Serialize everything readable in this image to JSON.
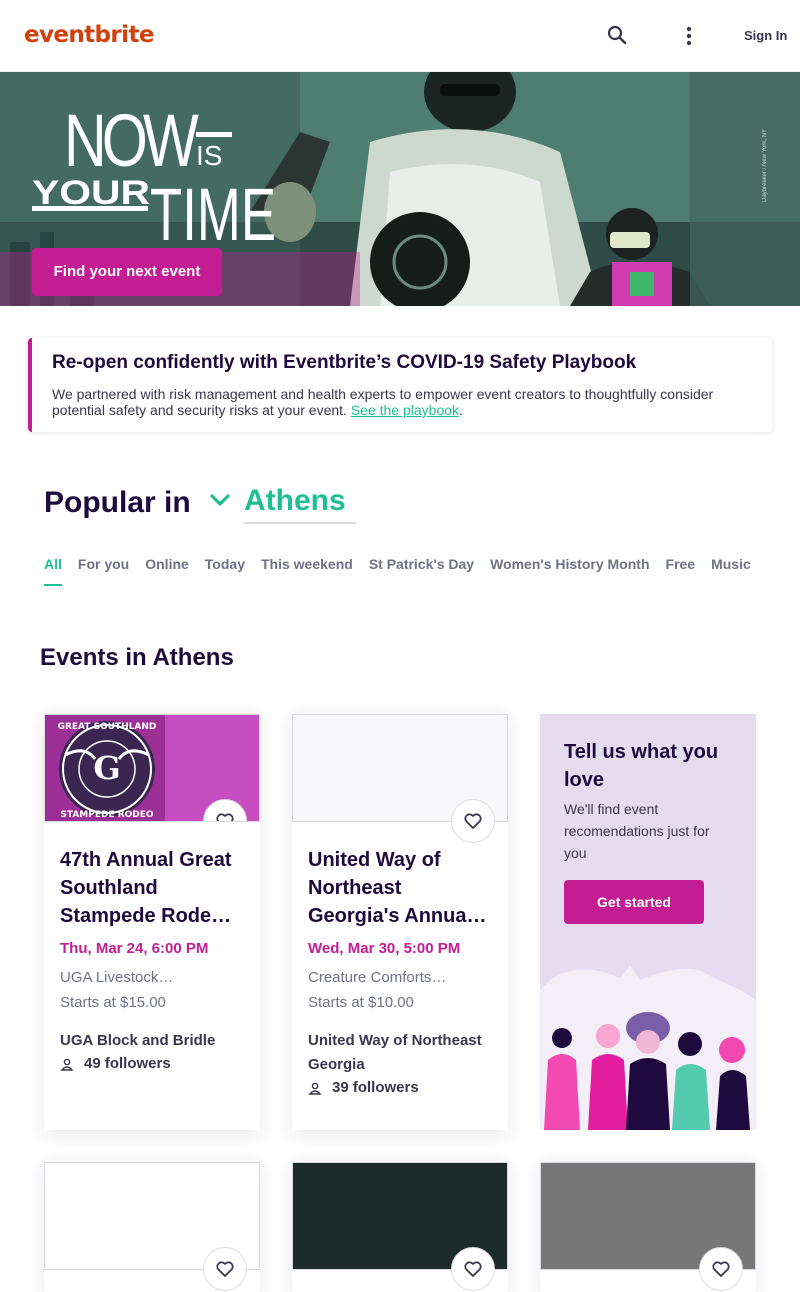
{
  "header": {
    "logo": "eventbrite",
    "search_icon": "search-icon",
    "menu_icon": "more-vertical-icon",
    "sign_in": "Sign In"
  },
  "hero": {
    "headline_top": "NOW",
    "headline_is": "IS",
    "headline_your": "YOUR",
    "headline_time": "TIME",
    "cta": "Find your next event",
    "credit": "Daybreaker / New York, NY"
  },
  "notice": {
    "title": "Re-open confidently with Eventbrite’s COVID-19 Safety Playbook",
    "body": "We partnered with risk management and health experts to empower event creators to thoughtfully consider potential safety and security risks at your event.",
    "link": "See the playbook",
    "suffix": "."
  },
  "popular": {
    "label": "Popular in",
    "city": "Athens",
    "tabs": [
      "All",
      "For you",
      "Online",
      "Today",
      "This weekend",
      "St Patrick's Day",
      "Women's History Month",
      "Free",
      "Music"
    ],
    "active_tab": "All"
  },
  "section": {
    "title": "Events in Athens"
  },
  "events": [
    {
      "title": "47th Annual Great Southland Stampede Rode…",
      "image_text_top": "GREAT SOUTHLAND",
      "image_text_bottom": "STAMPEDE RODEO",
      "date": "Thu, Mar 24, 6:00 PM",
      "venue": "UGA Livestock…",
      "price": "Starts at $15.00",
      "organizer": "UGA Block and Bridle",
      "followers": "49 followers"
    },
    {
      "title": "United Way of Northeast Georgia's Annua…",
      "date": "Wed, Mar 30, 5:00 PM",
      "venue": "Creature Comforts…",
      "price": "Starts at $10.00",
      "organizer": "United Way of Northeast Georgia",
      "followers": "39 followers"
    }
  ],
  "promo": {
    "title": "Tell us what you love",
    "body": "We'll find event recomendations just for you",
    "button": "Get started"
  },
  "colors": {
    "brand": "#d1410c",
    "accent": "#c21d92",
    "teal": "#1fbf96",
    "dark": "#1e0a3c"
  }
}
